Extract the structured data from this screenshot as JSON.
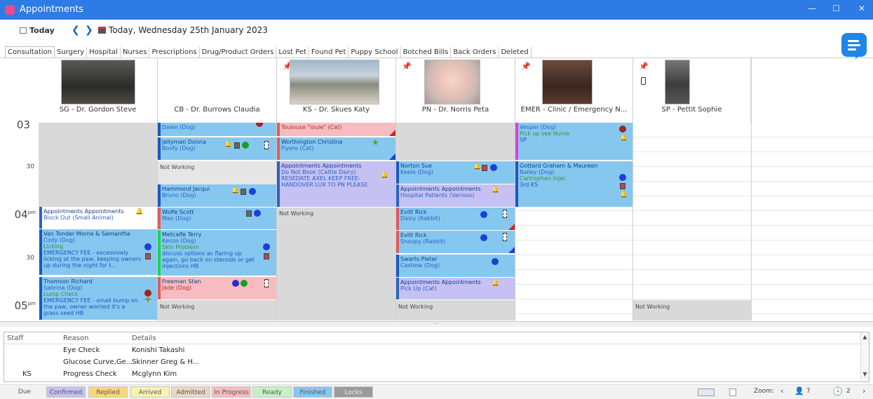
{
  "window": {
    "title": "Appointments",
    "minimize": "—",
    "maximize": "☐",
    "close": "✕"
  },
  "toolbar": {
    "today_label": "Today",
    "prev": "❮",
    "next": "❯",
    "date": "Today, Wednesday 25th January 2023"
  },
  "tabs": [
    "Consultation",
    "Surgery",
    "Hospital",
    "Nurses",
    "Prescriptions",
    "Drug/Product Orders",
    "Lost Pet",
    "Found Pet",
    "Puppy School",
    "Botched Bills",
    "Back Orders",
    "Deleted"
  ],
  "columns": [
    {
      "name": "SG - Dr. Gordon Steve"
    },
    {
      "name": "CB - Dr. Burrows Claudia"
    },
    {
      "name": "KS - Dr. Skues Katy"
    },
    {
      "name": "PN - Dr. Norris Peta"
    },
    {
      "name": "EMER - Clinic / Emergency N..."
    },
    {
      "name": "SP - Pettit Sophie"
    }
  ],
  "times": {
    "t03": "03",
    "t0330": "30",
    "t04": "04",
    "t0430": "30",
    "t05": "05",
    "pm": "pm"
  },
  "not_working": "Not Working",
  "appointments": {
    "a1": {
      "line1": "Dawn (Dog)"
    },
    "a2": {
      "line1": "Jellyman Donna",
      "line2": "Boofy (Dog)"
    },
    "a3": {
      "line1": "Hammond Jacqui",
      "line2": "Bruno (Dog)"
    },
    "a4": {
      "line1": "Appointments Appointments",
      "line2": "Block Out (Small Animal)"
    },
    "a5": {
      "line1": "Wolfe Scott",
      "line2": "Max (Dog)"
    },
    "a6": {
      "line1": "Van Tonder Morne & Samantha",
      "line2": "Cody (Dog)",
      "line3": "Licking",
      "line4": "EMERGENCY FEE - excessively licking at the paw, keeping owners up during the night for t..."
    },
    "a7": {
      "line1": "Metcalfe Terry",
      "line2": "Kenzo (Dog)",
      "line3": "Skin Problem",
      "line4": "discuss options as flaring up again, go back on steroids or get injections HB"
    },
    "a8": {
      "line1": "Thomson Richard",
      "line2": "Sabrina (Dog)",
      "line3": "Lump Check",
      "line4": "EMERGENCY FEE - small bump on the paw, owner worried it's a grass seed HB"
    },
    "a9": {
      "line1": "Freeman Stan",
      "line2": "Jade (Dog)"
    },
    "a10": {
      "line1": "Toulouse \"louie\" (Cat)"
    },
    "a11": {
      "line1": "Worthington Christine",
      "line2": "Fiyero (Cat)"
    },
    "a12": {
      "line1": "Appointments Appointments",
      "line2": "Do Not Book (Cattle Dairy)",
      "line3": "RESEDATE AXEL KEEP FREE-HANDOVER LUX TO PN PLEASE"
    },
    "a13": {
      "line1": "Norton Sue",
      "line2": "Keela (Dog)"
    },
    "a14": {
      "line1": "Appointments Appointments",
      "line2": "Hospital Patients (Various)"
    },
    "a15": {
      "line1": "Evitt Rick",
      "line2": "Daisy (Rabbit)"
    },
    "a16": {
      "line1": "Evitt Rick",
      "line2": "Snoopy (Rabbit)"
    },
    "a17": {
      "line1": "Swarts Pieter",
      "line2": "Cashew (Dog)"
    },
    "a18": {
      "line1": "Appointments Appointments",
      "line2": "Pick Up (Cat)"
    },
    "a19": {
      "line1": "Vesper (Dog)",
      "line2": "Pick up see Nurse",
      "line3": "SP"
    },
    "a20": {
      "line1": "Gottard Graham & Maureen",
      "line2": "Bailey (Dog)",
      "line3": "Cartrophen Injec",
      "line4": "3rd KS"
    }
  },
  "lower": {
    "headers": {
      "staff": "Staff",
      "reason": "Reason",
      "details": "Details"
    },
    "rows": [
      {
        "staff": "",
        "reason": "Eye Check",
        "details": "Konishi Takashi"
      },
      {
        "staff": "",
        "reason": "Glucose Curve,Ge...",
        "details": "Skinner Greg & H..."
      },
      {
        "staff": "KS",
        "reason": "Progress Check",
        "details": "Mcglynn Kim"
      }
    ]
  },
  "legend": [
    {
      "label": "Due",
      "color": "#f2f2f2"
    },
    {
      "label": "Confirmed",
      "color": "#c5c1f3"
    },
    {
      "label": "Replied",
      "color": "#f8d77a"
    },
    {
      "label": "Arrived",
      "color": "#f4f3b0"
    },
    {
      "label": "Admitted",
      "color": "#e9d7c4"
    },
    {
      "label": "In Progress",
      "color": "#f6bcbf"
    },
    {
      "label": "Ready",
      "color": "#c6f0c6"
    },
    {
      "label": "Finished",
      "color": "#86c7ef"
    },
    {
      "label": "Locks",
      "color": "#9b9b9b"
    }
  ],
  "status": {
    "zoom_label": "Zoom:",
    "zoom_prev": "‹",
    "zoom_value": "7",
    "clock_value": "2",
    "nav_next": "›"
  }
}
